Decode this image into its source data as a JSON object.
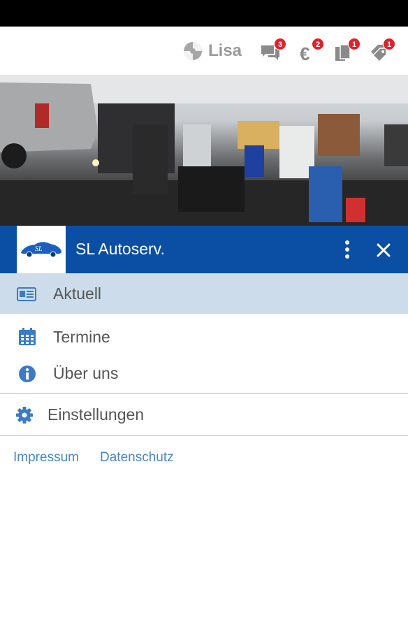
{
  "top_bar": {
    "user_name": "Lisa",
    "badges": {
      "messages": "3",
      "payments": "2",
      "documents": "1",
      "vouchers": "1"
    }
  },
  "app_bar": {
    "title": "SL Autoserv.",
    "logo_text": "SL"
  },
  "nav": {
    "items": [
      {
        "label": "Aktuell",
        "icon": "newspaper-icon",
        "active": true
      },
      {
        "label": "Termine",
        "icon": "calendar-icon",
        "active": false
      },
      {
        "label": "Über uns",
        "icon": "info-icon",
        "active": false
      },
      {
        "label": "Einstellungen",
        "icon": "gear-icon",
        "active": false
      }
    ]
  },
  "footer": {
    "impressum": "Impressum",
    "datenschutz": "Datenschutz"
  },
  "colors": {
    "primary": "#0a4fa3",
    "active_bg": "#ccdcea",
    "icon_blue": "#3b7bc4",
    "badge_red": "#e0202a",
    "link_blue": "#4a86c8"
  }
}
